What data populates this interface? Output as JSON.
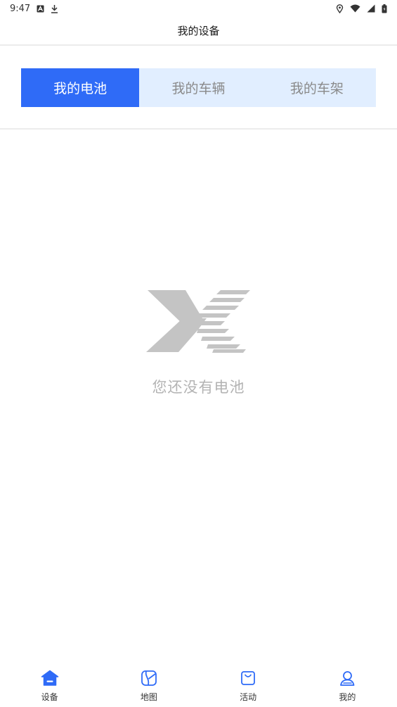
{
  "status_bar": {
    "time": "9:47",
    "left_icons": [
      "notification-a-icon",
      "download-icon"
    ],
    "right_icons": [
      "location-icon",
      "wifi-icon",
      "signal-icon",
      "battery-icon"
    ]
  },
  "header": {
    "title": "我的设备"
  },
  "tabs": [
    {
      "label": "我的电池",
      "active": true
    },
    {
      "label": "我的车辆",
      "active": false
    },
    {
      "label": "我的车架",
      "active": false
    }
  ],
  "empty_state": {
    "icon": "brand-logo-icon",
    "message": "您还没有电池"
  },
  "bottom_nav": {
    "items": [
      {
        "label": "设备",
        "icon": "home-icon",
        "active": true
      },
      {
        "label": "地图",
        "icon": "map-icon",
        "active": false
      },
      {
        "label": "活动",
        "icon": "bag-icon",
        "active": false
      },
      {
        "label": "我的",
        "icon": "user-icon",
        "active": false
      }
    ]
  },
  "colors": {
    "accent": "#2f6bf7",
    "tab_background": "#e1eeff",
    "inactive_text": "#8a8a8a",
    "empty_text": "#b3b3b3",
    "logo_gray": "#c4c4c4"
  }
}
